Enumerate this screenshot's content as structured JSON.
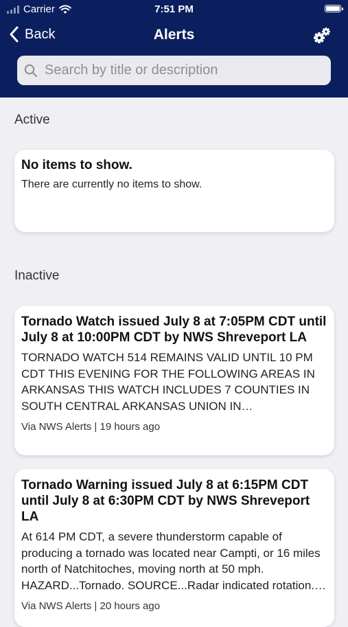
{
  "status_bar": {
    "carrier": "Carrier",
    "time": "7:51 PM"
  },
  "nav": {
    "back_label": "Back",
    "title": "Alerts"
  },
  "search": {
    "placeholder": "Search by title or description"
  },
  "active": {
    "label": "Active",
    "empty_title": "No items to show.",
    "empty_text": "There are currently no items to show."
  },
  "inactive": {
    "label": "Inactive",
    "alerts": [
      {
        "title": "Tornado Watch issued July 8 at 7:05PM CDT until July 8 at 10:00PM CDT by NWS Shreveport LA",
        "description": "TORNADO WATCH 514 REMAINS VALID UNTIL 10 PM CDT THIS EVENING FOR THE FOLLOWING AREAS IN ARKANSAS THIS WATCH INCLUDES 7 COUNTIES IN SOUTH CENTRAL ARKANSAS UNION IN SOUTHWEST…",
        "meta": "Via NWS Alerts | 19 hours ago"
      },
      {
        "title": "Tornado Warning issued July 8 at 6:15PM CDT until July 8 at 6:30PM CDT by NWS Shreveport LA",
        "description": "At 614 PM CDT, a severe thunderstorm capable of producing a tornado was located near Campti, or 16 miles north of Natchitoches, moving north at 50 mph. HAZARD...Tornado. SOURCE...Radar indicated rotation.…",
        "meta": "Via NWS Alerts | 20 hours ago"
      }
    ]
  },
  "colors": {
    "header": "#0b1f5e",
    "background": "#efeff4"
  }
}
